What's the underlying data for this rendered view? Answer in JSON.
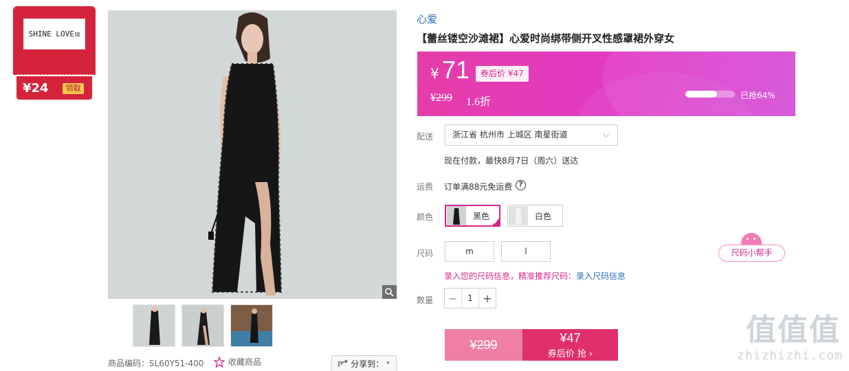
{
  "coupon": {
    "logo_text": "SHINE LOVE ",
    "amount": "¥24",
    "claim_label": "领取"
  },
  "gallery": {
    "item_code": "商品编码：SL60Y51-400",
    "favorite_label": "收藏商品",
    "share_label": "分享到：",
    "share_arrow": "▾"
  },
  "product": {
    "brand": "心爱",
    "title": "【蕾丝镂空沙滩裙】心爱时尚绑带侧开叉性感罩裙外穿女"
  },
  "price": {
    "yen": "¥",
    "current": "71",
    "after_coupon_tag": "券后价 ¥47",
    "original": "¥299",
    "discount": "1.6折",
    "sold_progress": 0.64,
    "sold_text": "已抢64%"
  },
  "delivery": {
    "label": "配送",
    "address": "浙江省 杭州市 上城区 南星街道",
    "chevron": "⌵",
    "note": "现在付款，最快8月7日（周六）送达"
  },
  "shipping": {
    "label": "运费",
    "text": "订单满88元免运费",
    "help": "?"
  },
  "color": {
    "label": "颜色",
    "options": [
      {
        "name": "黑色",
        "selected": true
      },
      {
        "name": "白色",
        "selected": false
      }
    ]
  },
  "size": {
    "label": "尺码",
    "options": [
      "m",
      "l"
    ],
    "note": "录入您的尺码信息，精准推荐尺码：",
    "note_link": "录入尺码信息",
    "helper_label": "尺码小帮手"
  },
  "quantity": {
    "label": "数量",
    "minus": "−",
    "value": "1",
    "plus": "+"
  },
  "buy": {
    "original": "¥299",
    "price": "¥47",
    "action": "券后价 抢 ›"
  },
  "watermark": {
    "big": "值值值",
    "small": "zhizhizhi.com"
  }
}
